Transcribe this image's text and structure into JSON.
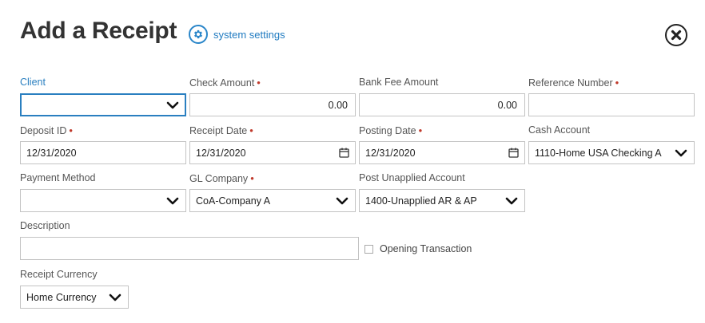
{
  "header": {
    "title": "Add a Receipt",
    "settings_label": "system settings",
    "settings_icon": "gear-icon",
    "close_icon": "close-icon"
  },
  "colors": {
    "accent": "#2a7fc0",
    "required": "#c0392b"
  },
  "fields": {
    "client": {
      "label": "Client",
      "value": ""
    },
    "check_amount": {
      "label": "Check Amount",
      "value": "0.00",
      "required": true
    },
    "bank_fee_amount": {
      "label": "Bank Fee Amount",
      "value": "0.00"
    },
    "reference_number": {
      "label": "Reference Number",
      "value": "",
      "required": true
    },
    "deposit_id": {
      "label": "Deposit ID",
      "value": "12/31/2020",
      "required": true
    },
    "receipt_date": {
      "label": "Receipt Date",
      "value": "12/31/2020",
      "required": true
    },
    "posting_date": {
      "label": "Posting Date",
      "value": "12/31/2020",
      "required": true
    },
    "cash_account": {
      "label": "Cash Account",
      "value": "1110-Home USA Checking A"
    },
    "payment_method": {
      "label": "Payment Method",
      "value": ""
    },
    "gl_company": {
      "label": "GL Company",
      "value": "CoA-Company A",
      "required": true
    },
    "post_unapplied_account": {
      "label": "Post Unapplied Account",
      "value": "1400-Unapplied AR & AP"
    },
    "description": {
      "label": "Description",
      "value": ""
    },
    "opening_transaction": {
      "label": "Opening Transaction",
      "checked": false
    },
    "receipt_currency": {
      "label": "Receipt Currency",
      "value": "Home Currency"
    }
  },
  "required_marker": "•"
}
